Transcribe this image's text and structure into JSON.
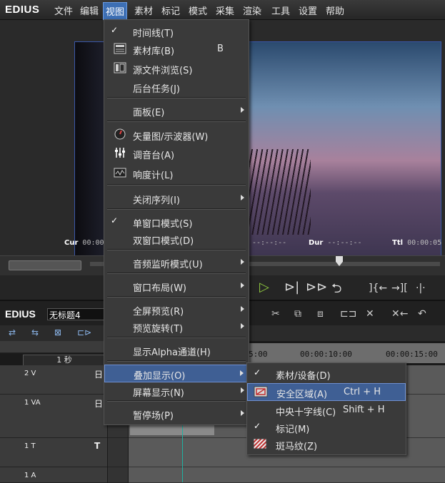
{
  "app": {
    "logo": "EDIUS"
  },
  "menubar": [
    "文件",
    "编辑",
    "视图",
    "素材",
    "标记",
    "模式",
    "采集",
    "渲染",
    "工具",
    "设置",
    "帮助"
  ],
  "preview": {
    "cur_label": "Cur",
    "cur_value": "00:00",
    "in_value": "--:--:--",
    "dur_label": "Dur",
    "dur_value": "--:--:--",
    "ttl_label": "Ttl",
    "ttl_value": "00:00:05"
  },
  "timeline": {
    "logo": "EDIUS",
    "sequence_name": "无标题4",
    "zoom": "1 秒",
    "ruler": [
      "5:00",
      "00:00:10:00",
      "00:00:15:00"
    ],
    "tracks": [
      {
        "name": "2 V",
        "mark": "日"
      },
      {
        "name": "1 VA",
        "mark": "日"
      },
      {
        "name": "1 T",
        "mark": "T"
      },
      {
        "name": "1 A",
        "mark": ""
      }
    ]
  },
  "view_menu": {
    "items": [
      {
        "label": "时间线(T)",
        "check": "✓"
      },
      {
        "label": "素材库(B)",
        "shortcut": "B",
        "icon": "bin-icon"
      },
      {
        "label": "源文件浏览(S)",
        "icon": "browser-icon"
      },
      {
        "label": "后台任务(J)"
      },
      {
        "label": "面板(E)",
        "submenu": true
      },
      {
        "label": "矢量图/示波器(W)",
        "icon": "vectorscope-icon"
      },
      {
        "label": "调音台(A)",
        "icon": "mixer-icon"
      },
      {
        "label": "响度计(L)",
        "icon": "loudness-icon"
      },
      {
        "label": "关闭序列(I)",
        "submenu": true
      },
      {
        "label": "单窗口模式(S)",
        "check": "✓"
      },
      {
        "label": "双窗口模式(D)"
      },
      {
        "label": "音频监听模式(U)",
        "submenu": true
      },
      {
        "label": "窗口布局(W)",
        "submenu": true
      },
      {
        "label": "全屏预览(R)",
        "submenu": true
      },
      {
        "label": "预览旋转(T)",
        "submenu": true
      },
      {
        "label": "显示Alpha通道(H)"
      },
      {
        "label": "叠加显示(O)",
        "submenu": true,
        "highlight": true
      },
      {
        "label": "屏幕显示(N)",
        "submenu": true
      },
      {
        "label": "暂停场(P)",
        "submenu": true
      }
    ]
  },
  "overlay_menu": {
    "items": [
      {
        "label": "素材/设备(D)",
        "check": "✓"
      },
      {
        "label": "安全区域(A)",
        "shortcut": "Ctrl + H",
        "icon": "safe-area-icon",
        "highlight": true
      },
      {
        "label": "中央十字线(C)",
        "shortcut": "Shift + H"
      },
      {
        "label": "标记(M)",
        "check": "✓"
      },
      {
        "label": "斑马纹(Z)",
        "icon": "zebra-icon"
      }
    ]
  }
}
